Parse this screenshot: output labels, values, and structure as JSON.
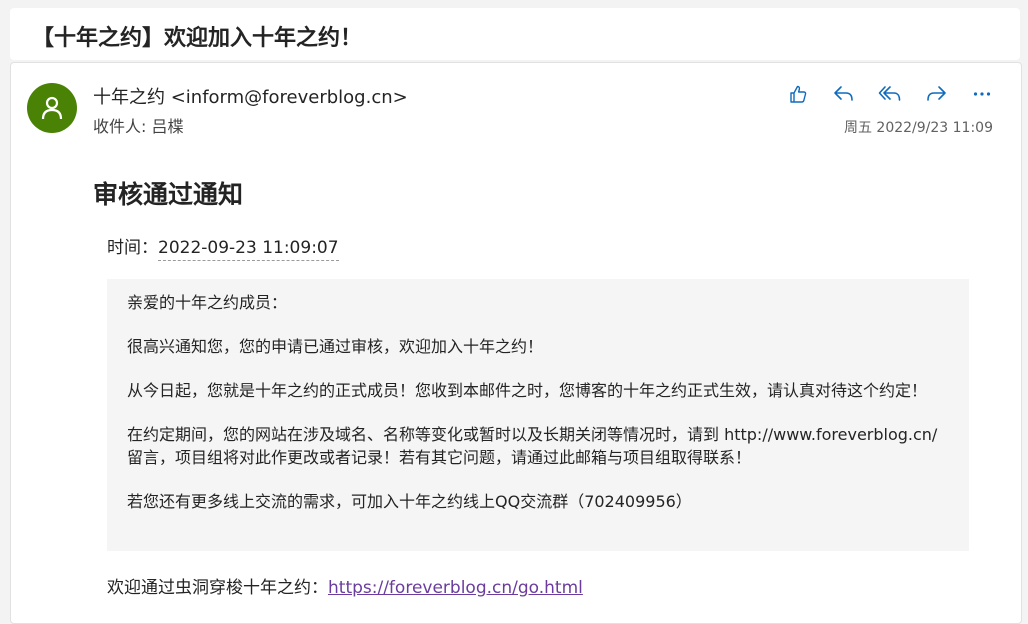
{
  "subject": "【十年之约】欢迎加入十年之约！",
  "sender": {
    "display": "十年之约 <inform@foreverblog.cn>",
    "recipients": "收件人: 吕楪"
  },
  "date": "周五 2022/9/23 11:09",
  "actions": [
    {
      "icon": "like-icon"
    },
    {
      "icon": "reply-icon"
    },
    {
      "icon": "reply-all-icon"
    },
    {
      "icon": "forward-icon"
    },
    {
      "icon": "more-icon"
    }
  ],
  "body": {
    "title": "审核通过通知",
    "time_label": "时间：",
    "time_value": "2022-09-23 11:09:07",
    "paragraphs": [
      "亲爱的十年之约成员：",
      "很高兴通知您，您的申请已通过审核，欢迎加入十年之约！",
      "从今日起，您就是十年之约的正式成员！您收到本邮件之时，您博客的十年之约正式生效，请认真对待这个约定！",
      "在约定期间，您的网站在涉及域名、名称等变化或暂时以及长期关闭等情况时，请到 http://www.foreverblog.cn/ 留言，项目组将对此作更改或者记录！若有其它问题，请通过此邮箱与项目组取得联系！",
      "若您还有更多线上交流的需求，可加入十年之约线上QQ交流群（702409956）"
    ],
    "footer_label": "欢迎通过虫洞穿梭十年之约：",
    "footer_link": "https://foreverblog.cn/go.html"
  },
  "colors": {
    "avatar": "#498205",
    "accent": "#0f6cbd",
    "link_visited": "#6b3c9e"
  }
}
